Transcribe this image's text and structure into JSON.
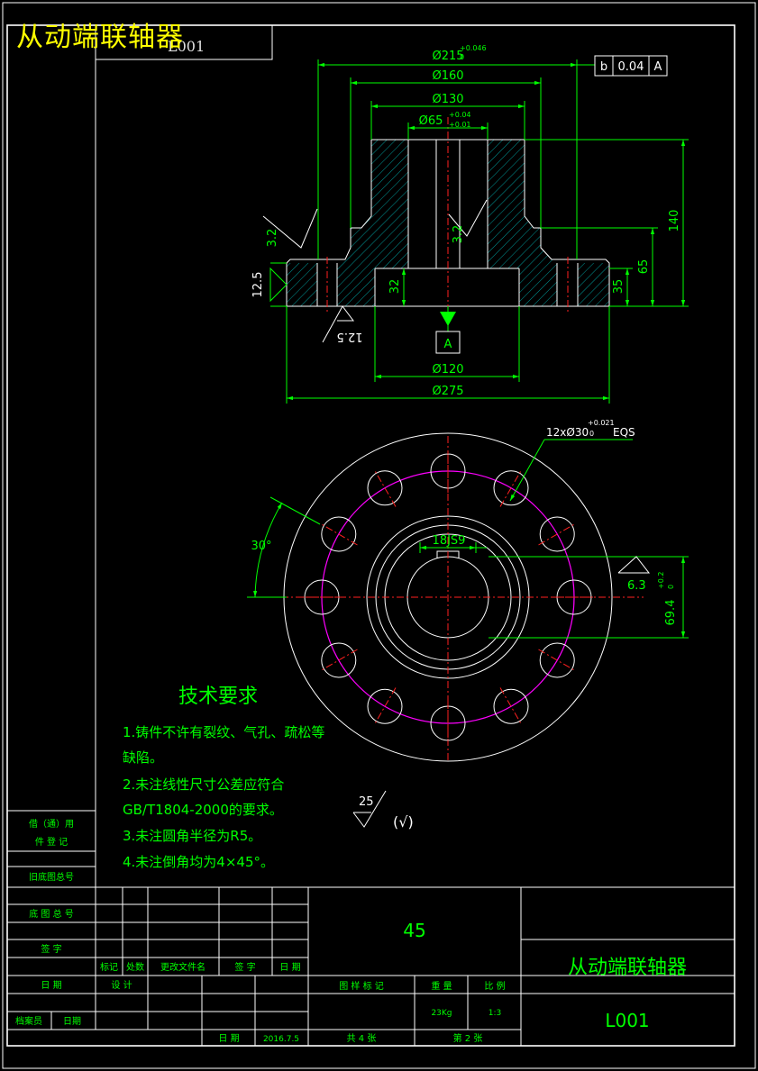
{
  "overlay_title": "从动端联轴器",
  "tr_code": "L001",
  "dims": {
    "d215": "Ø215",
    "d215_tol": "+0.046",
    "d215_tol_low": "0",
    "d160": "Ø160",
    "d130": "Ø130",
    "d65": "Ø65",
    "d65_tol_up": "+0.04",
    "d65_tol_low": "+0.01",
    "d120": "Ø120",
    "d275": "Ø275",
    "h140": "140",
    "h65": "65",
    "h35": "35",
    "h32": "32",
    "r32_left": "3.2",
    "r32_mid": "3.2",
    "r125_left": "12.5",
    "r125_bottom": "12.5",
    "holes": "12xØ30",
    "holes_tol_up": "+0.021",
    "holes_tol_low": "0",
    "holes_eqs": "EQS",
    "angle30": "30°",
    "keyway": "18JS9",
    "r63": "6.3",
    "d694": "69.4",
    "d694_tol_up": "+0.2",
    "d694_tol_low": "0",
    "rough25": "25",
    "rough_check": "(√)"
  },
  "geo_tol": {
    "sym": "b",
    "val": "0.04",
    "datum": "A"
  },
  "datum_label": "A",
  "tech": {
    "title": "技术要求",
    "l1": "1.铸件不许有裂纹、气孔、疏松等",
    "l1b": "缺陷。",
    "l2": "2.未注线性尺寸公差应符合",
    "l2b": "GB/T1804-2000的要求。",
    "l3": "3.未注圆角半径为R5。",
    "l4": "4.未注倒角均为4×45°。"
  },
  "left_strip": {
    "a1": "借（通）用",
    "a2": "件 登 记",
    "b": "旧底图总号",
    "c": "底 图 总 号",
    "d": "签   字",
    "e": "日   期",
    "f1": "档案员",
    "f2": "日期"
  },
  "title_block": {
    "material": "45",
    "name": "从动端联轴器",
    "code": "L001",
    "mark": "标记",
    "count": "处数",
    "change_doc": "更改文件名",
    "sign": "签  字",
    "date_h": "日  期",
    "design": "设  计",
    "date_l": "日  期",
    "date_v": "2016.7.5",
    "stage": "图 样 标 记",
    "weight_h": "重 量",
    "scale_h": "比 例",
    "weight_v": "23Kg",
    "scale_v": "1:3",
    "total": "共   4   张",
    "page": "第   2   张"
  }
}
